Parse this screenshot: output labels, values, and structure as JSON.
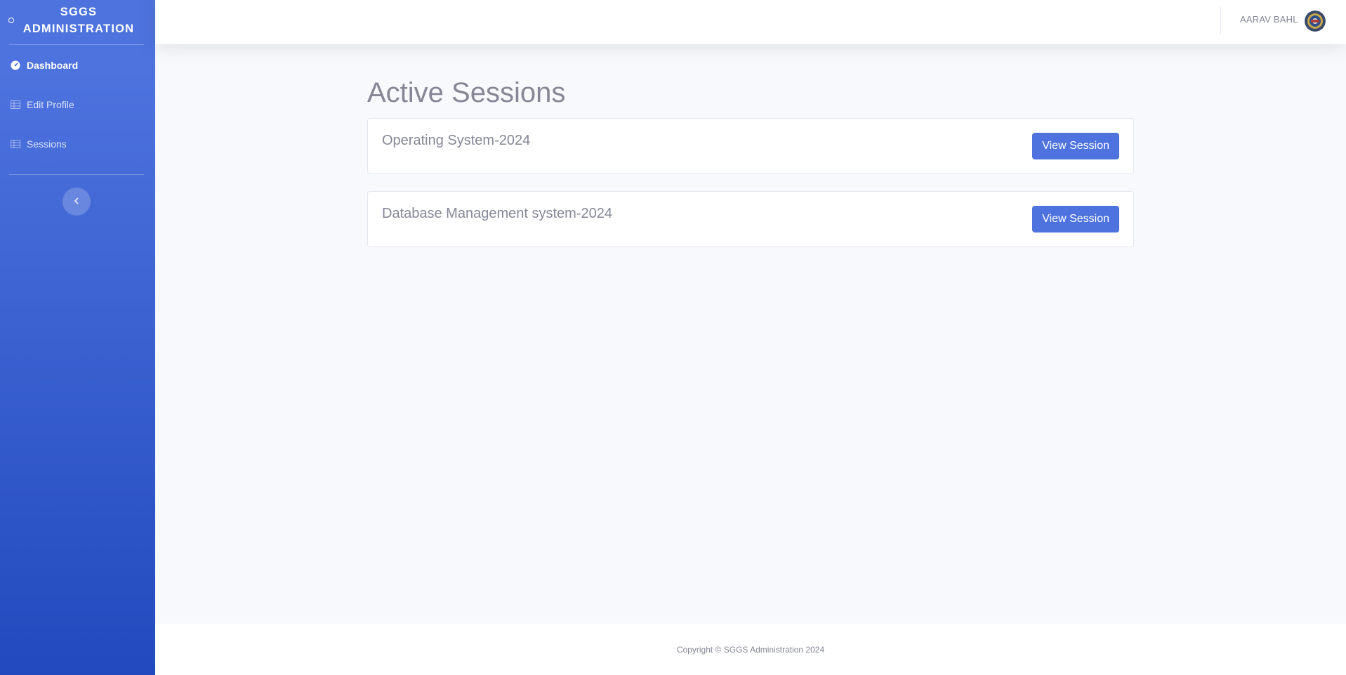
{
  "sidebar": {
    "brand": "SGGS ADMINISTRATION",
    "items": [
      {
        "label": "Dashboard",
        "icon": "tachometer-icon",
        "active": true
      },
      {
        "label": "Edit Profile",
        "icon": "table-icon",
        "active": false
      },
      {
        "label": "Sessions",
        "icon": "table-icon",
        "active": false
      }
    ],
    "toggle_icon": "chevron-left-icon"
  },
  "topbar": {
    "user_name": "AARAV BAHL",
    "avatar_icon": "user-avatar"
  },
  "main": {
    "title": "Active Sessions",
    "sessions": [
      {
        "name": "Operating System-2024",
        "button": "View Session"
      },
      {
        "name": "Database Management system-2024",
        "button": "View Session"
      }
    ]
  },
  "footer": {
    "text": "Copyright © SGGS Administration 2024"
  },
  "colors": {
    "primary": "#4e73df",
    "primary_dark": "#224abe",
    "text_muted": "#858796",
    "background": "#f8f9fc"
  }
}
